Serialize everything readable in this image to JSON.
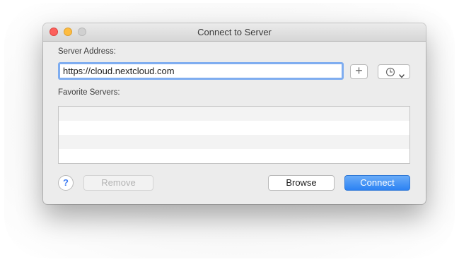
{
  "window": {
    "title": "Connect to Server"
  },
  "server_address": {
    "label": "Server Address:",
    "value": "https://cloud.nextcloud.com"
  },
  "favorites": {
    "label": "Favorite Servers:",
    "items": []
  },
  "buttons": {
    "add_label": "+",
    "help_label": "?",
    "remove_label": "Remove",
    "browse_label": "Browse",
    "connect_label": "Connect"
  },
  "icons": {
    "close": "close-traffic-light",
    "minimize": "minimize-traffic-light",
    "zoom": "zoom-traffic-light",
    "recent": "clock-icon",
    "chevron": "chevron-down-icon"
  },
  "colors": {
    "accent": "#2c82f3",
    "focus_ring": "#7fadf0",
    "close": "#fc605c",
    "minimize": "#fdbc40",
    "zoom_disabled": "#d0d0d0"
  }
}
